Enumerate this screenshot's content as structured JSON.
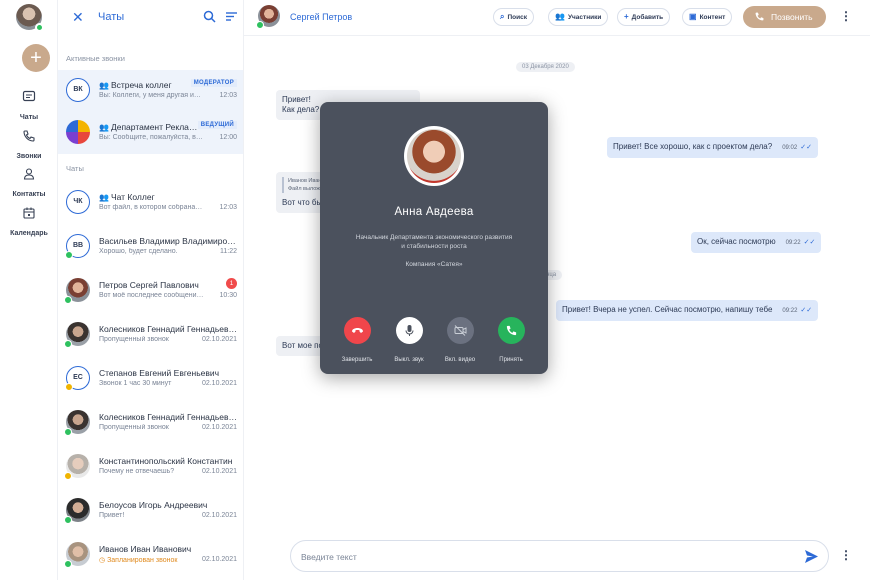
{
  "rail": {
    "nav": [
      {
        "label": "Чаты",
        "icon": "chat-icon"
      },
      {
        "label": "Звонки",
        "icon": "phone-icon"
      },
      {
        "label": "Контакты",
        "icon": "person-icon"
      },
      {
        "label": "Календарь",
        "icon": "calendar-icon"
      }
    ]
  },
  "list": {
    "title": "Чаты",
    "section_active": "Активные звонки",
    "section_chats": "Чаты",
    "active_calls": [
      {
        "initials": "ВК",
        "name": "Встреча коллег",
        "tag": "МОДЕРАТОР",
        "msg": "Вы: Коллеги, у меня другая информация",
        "time": "12:03"
      },
      {
        "initials": "",
        "name": "Департамент Рекламы",
        "tag": "ВЕДУЩИЙ",
        "msg": "Вы: Сообщите, пожалуйста, в какое время",
        "time": "12:00"
      }
    ],
    "chats": [
      {
        "initials": "ЧК",
        "name": "Чат Коллег",
        "msg": "Вот файл, в котором собрана вся информация",
        "time": "12:03"
      },
      {
        "initials": "ВВ",
        "name": "Васильев Владимир Владимирович",
        "msg": "Хорошо, будет сделано.",
        "time": "11:22"
      },
      {
        "initials": "",
        "name": "Петров Сергей Павлович",
        "msg": "Вот моё последнее сообщение в этом чате",
        "time": "10:30",
        "badge": "1"
      },
      {
        "initials": "",
        "name": "Колесников Геннадий Геннадьевич",
        "msg": "Пропущенный звонок",
        "time": "02.10.2021"
      },
      {
        "initials": "ЕС",
        "name": "Степанов Евгений Евгеньевич",
        "msg": "Звонок 1 час 30 минут",
        "time": "02.10.2021"
      },
      {
        "initials": "",
        "name": "Колесников Геннадий Геннадьевич",
        "msg": "Пропущенный звонок",
        "time": "02.10.2021"
      },
      {
        "initials": "",
        "name": "Константинопольский Константин",
        "msg": "Почему не отвечаешь?",
        "time": "02.10.2021"
      },
      {
        "initials": "",
        "name": "Белоусов Игорь Андреевич",
        "msg": "Привет!",
        "time": "02.10.2021"
      },
      {
        "initials": "",
        "name": "Иванов Иван Иванович",
        "msg": "Запланирован звонок",
        "time": "02.10.2021"
      }
    ]
  },
  "chat": {
    "contact": "Сергей Петров",
    "actions": {
      "search": "Поиск",
      "members": "Участники",
      "add": "Добавить",
      "content": "Контент"
    },
    "call_label": "Позвонить",
    "date": "03 Декабря 2020",
    "messages": {
      "m1_l1": "Привет!",
      "m1_l2": "Как дела?",
      "m2": "Привет! Все хорошо, как с проектом дела?",
      "m2_time": "09:02",
      "q_author": "Иванов Иван",
      "q_file": "Файл выложен",
      "m3": "Вот что было",
      "m4": "Ок, сейчас посмотрю",
      "m4_time": "09:22",
      "sys": "нца",
      "m5": "Привет! Вчера не успел. Сейчас посмотрю, напишу тебе",
      "m5_time": "09:22",
      "m6": "Вот мое по"
    },
    "input_placeholder": "Введите текст"
  },
  "call": {
    "name": "Анна Авдеева",
    "role": "Начальник Департамента экономического развития и стабильности роста",
    "company": "Компания «Сатея»",
    "buttons": {
      "end": "Завершить",
      "mute": "Выкл. звук",
      "video": "Вкл. видео",
      "accept": "Принять"
    }
  },
  "colors": {
    "accent": "#2d6ad6",
    "call_brown": "#c9a98c",
    "end_red": "#f0464b",
    "accept_green": "#27b45c",
    "modal_bg": "#4b515d"
  }
}
